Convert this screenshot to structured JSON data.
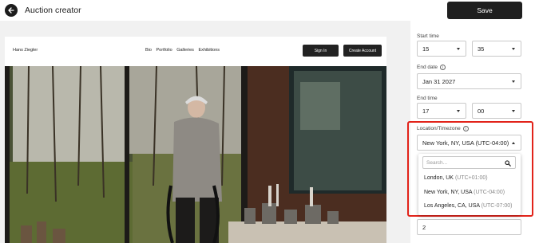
{
  "header": {
    "back_icon": "arrow-left-icon",
    "title": "Auction creator",
    "save_label": "Save"
  },
  "preview": {
    "artist_name": "Hans Ziegler",
    "nav": [
      "Bio",
      "Portfolio",
      "Galleries",
      "Exhibitions"
    ],
    "sign_in_label": "Sign In",
    "create_account_label": "Create Account"
  },
  "panel": {
    "start_time_label": "Start time",
    "start_hour": "15",
    "start_minute": "35",
    "end_date_label": "End date",
    "end_date": "Jan 31 2027",
    "end_time_label": "End time",
    "end_hour": "17",
    "end_minute": "00",
    "location_label": "Location/Timezone",
    "location_value": "New York, NY, USA (UTC-04:00)",
    "below_value": "2"
  },
  "dropdown": {
    "search_placeholder": "Search...",
    "options": [
      {
        "name": "London, UK",
        "offset": "(UTC+01:00)"
      },
      {
        "name": "New York, NY, USA",
        "offset": "(UTC-04:00)"
      },
      {
        "name": "Los Angeles, CA, USA",
        "offset": "(UTC-07:00)"
      }
    ]
  },
  "colors": {
    "highlight": "#e2231a",
    "primary_button": "#1f1f1f"
  }
}
